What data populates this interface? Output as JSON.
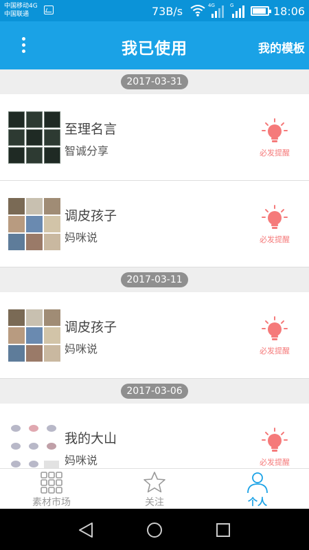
{
  "status_bar": {
    "carrier_1": "中国移动4G",
    "carrier_2": "中国联通",
    "speed": "73B/s",
    "network_tags": [
      "4G",
      "G"
    ],
    "time": "18:06",
    "icons": [
      "gallery-icon",
      "wifi-icon",
      "signal-icon",
      "battery-icon"
    ]
  },
  "app_bar": {
    "title": "我已使用",
    "right_action": "我的模板",
    "menu_icon": "overflow-menu-icon"
  },
  "sections": [
    {
      "date": "2017-03-31",
      "items": [
        {
          "title": "至理名言",
          "subtitle": "智诚分享",
          "thumbnail": "dark-collage",
          "action_label": "必发提醒",
          "action_icon": "bulb-icon"
        },
        {
          "title": "调皮孩子",
          "subtitle": "妈咪说",
          "thumbnail": "photo-collage",
          "action_label": "必发提醒",
          "action_icon": "bulb-icon"
        }
      ]
    },
    {
      "date": "2017-03-11",
      "items": [
        {
          "title": "调皮孩子",
          "subtitle": "妈咪说",
          "thumbnail": "photo-collage",
          "action_label": "必发提醒",
          "action_icon": "bulb-icon"
        }
      ]
    },
    {
      "date": "2017-03-06",
      "items": [
        {
          "title": "我的大山",
          "subtitle": "妈咪说",
          "thumbnail": "sketch-collage",
          "action_label": "必发提醒",
          "action_icon": "bulb-icon"
        }
      ]
    }
  ],
  "tab_bar": {
    "tabs": [
      {
        "label": "素材市场",
        "icon": "grid-icon",
        "active": false
      },
      {
        "label": "关注",
        "icon": "star-icon",
        "active": false
      },
      {
        "label": "个人",
        "icon": "person-icon",
        "active": true
      }
    ]
  },
  "nav_bar": {
    "buttons": [
      "back-icon",
      "home-icon",
      "recents-icon"
    ]
  },
  "colors": {
    "status_bar": "#0b93d8",
    "app_bar": "#1aa2e6",
    "accent_active_tab": "#1aa2e6",
    "remind": "#f57a7a",
    "date_badge": "#8f8f8f"
  }
}
